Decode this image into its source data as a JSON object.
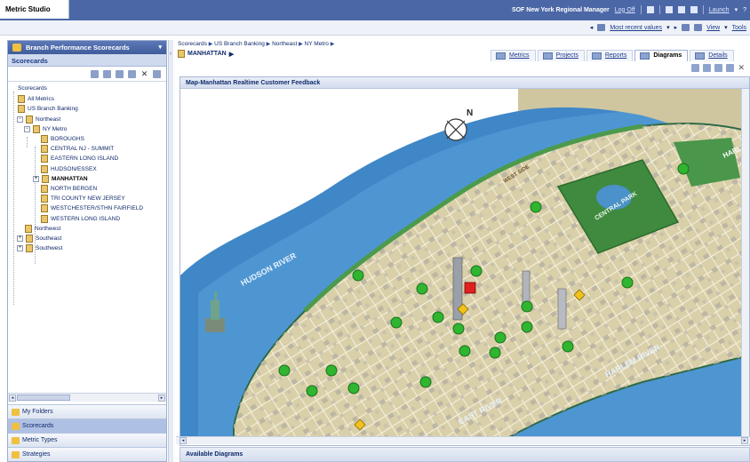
{
  "app": {
    "title": "Metric Studio"
  },
  "topbar": {
    "user": "SOF New York Regional Manager",
    "logoff": "Log Off",
    "launch": "Launch"
  },
  "toolbar2": {
    "values_mode": "Most recent values",
    "view": "View",
    "tools": "Tools"
  },
  "left_panel": {
    "header": "Branch Performance Scorecards",
    "section": "Scorecards",
    "tree": [
      {
        "label": "Scorecards",
        "level": 0,
        "expander": "",
        "icon": false,
        "bold": false
      },
      {
        "label": "All Metrics",
        "level": 0,
        "expander": "",
        "icon": true,
        "bold": false
      },
      {
        "label": "US Branch Banking",
        "level": 0,
        "expander": "",
        "icon": true,
        "bold": false
      },
      {
        "label": "Northeast",
        "level": 1,
        "expander": "−",
        "icon": true,
        "bold": false
      },
      {
        "label": "NY Metro",
        "level": 2,
        "expander": "−",
        "icon": true,
        "bold": false
      },
      {
        "label": "BOROUGHS",
        "level": 3,
        "expander": "",
        "icon": true,
        "bold": false
      },
      {
        "label": "CENTRAL NJ - SUMMIT",
        "level": 3,
        "expander": "",
        "icon": true,
        "bold": false
      },
      {
        "label": "EASTERN LONG ISLAND",
        "level": 3,
        "expander": "",
        "icon": true,
        "bold": false
      },
      {
        "label": "HUDSON/ESSEX",
        "level": 3,
        "expander": "",
        "icon": true,
        "bold": false
      },
      {
        "label": "MANHATTAN",
        "level": 3,
        "expander": "+",
        "icon": true,
        "bold": true
      },
      {
        "label": "NORTH BERGEN",
        "level": 3,
        "expander": "",
        "icon": true,
        "bold": false
      },
      {
        "label": "TRI COUNTY NEW JERSEY",
        "level": 3,
        "expander": "",
        "icon": true,
        "bold": false
      },
      {
        "label": "WESTCHESTER/STHN FAIRFIELD",
        "level": 3,
        "expander": "",
        "icon": true,
        "bold": false
      },
      {
        "label": "WESTERN LONG ISLAND",
        "level": 3,
        "expander": "",
        "icon": true,
        "bold": false
      },
      {
        "label": "Northwest",
        "level": 1,
        "expander": "",
        "icon": true,
        "bold": false
      },
      {
        "label": "Southeast",
        "level": 1,
        "expander": "+",
        "icon": true,
        "bold": false
      },
      {
        "label": "Southwest",
        "level": 1,
        "expander": "+",
        "icon": true,
        "bold": false
      }
    ],
    "accordion": [
      {
        "label": "My Folders",
        "active": false
      },
      {
        "label": "Scorecards",
        "active": true
      },
      {
        "label": "Metric Types",
        "active": false
      },
      {
        "label": "Strategies",
        "active": false
      }
    ]
  },
  "main": {
    "breadcrumb": [
      "Scorecards",
      "US Branch Banking",
      "Northeast",
      "NY Metro"
    ],
    "entity": "MANHATTAN",
    "tabs": [
      {
        "label": "Metrics",
        "active": false
      },
      {
        "label": "Projects",
        "active": false
      },
      {
        "label": "Reports",
        "active": false
      },
      {
        "label": "Diagrams",
        "active": true
      },
      {
        "label": "Details",
        "active": false
      }
    ],
    "diagram_title": "Map-Manhattan Realtime Customer Feedback",
    "available": "Available Diagrams",
    "map_labels": {
      "hudson": "HUDSON RIVER",
      "harlem": "HARLEM RIVER",
      "east": "EAST RIVER",
      "central": "CENTRAL PARK",
      "harlem_area": "HARLE",
      "west_side": "WEST SIDE",
      "compass_n": "N"
    },
    "colors": {
      "green": "#2fb52f",
      "yellow": "#f2c21c",
      "red": "#e02020"
    }
  }
}
